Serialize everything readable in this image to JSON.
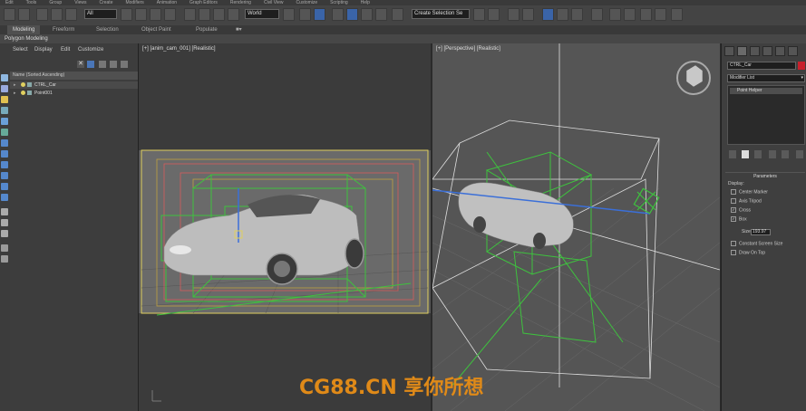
{
  "menu": [
    "Edit",
    "Tools",
    "Group",
    "Views",
    "Create",
    "Modifiers",
    "Animation",
    "Graph Editors",
    "Rendering",
    "Civil View",
    "Customize",
    "Scripting",
    "Help"
  ],
  "toolbar": {
    "selection_filter": "All",
    "ref_coord": "World",
    "named_selection_set": "Create Selection Se"
  },
  "ribbon": {
    "tabs": [
      "Modeling",
      "Freeform",
      "Selection",
      "Object Paint",
      "Populate"
    ],
    "active_tab": "Modeling",
    "sub_label": "Polygon Modeling"
  },
  "scene_explorer": {
    "menu": [
      "Select",
      "Display",
      "Edit",
      "Customize"
    ],
    "header": "Name (Sorted Ascending)",
    "rows": [
      {
        "name": "CTRL_Car"
      },
      {
        "name": "Point001"
      }
    ]
  },
  "viewports": {
    "left_label": "[+] [anim_cam_001] [Realistic]",
    "right_label": "[+] [Perspective] [Realistic]"
  },
  "command_panel": {
    "object_name": "CTRL_Car",
    "object_color": "#c8202c",
    "modifier_list": "Modifier List",
    "stack_item": "Point Helper",
    "rollout_title": "Parameters",
    "display_label": "Display:",
    "options": [
      {
        "label": "Center Marker",
        "checked": false
      },
      {
        "label": "Axis Tripod",
        "checked": false
      },
      {
        "label": "Cross",
        "checked": true
      },
      {
        "label": "Box",
        "checked": true
      }
    ],
    "size_label": "Size:",
    "size_value": "193.97",
    "extra_options": [
      {
        "label": "Constant Screen Size",
        "checked": false
      },
      {
        "label": "Draw On Top",
        "checked": false
      }
    ]
  },
  "watermark": "CG88.CN 享你所想"
}
